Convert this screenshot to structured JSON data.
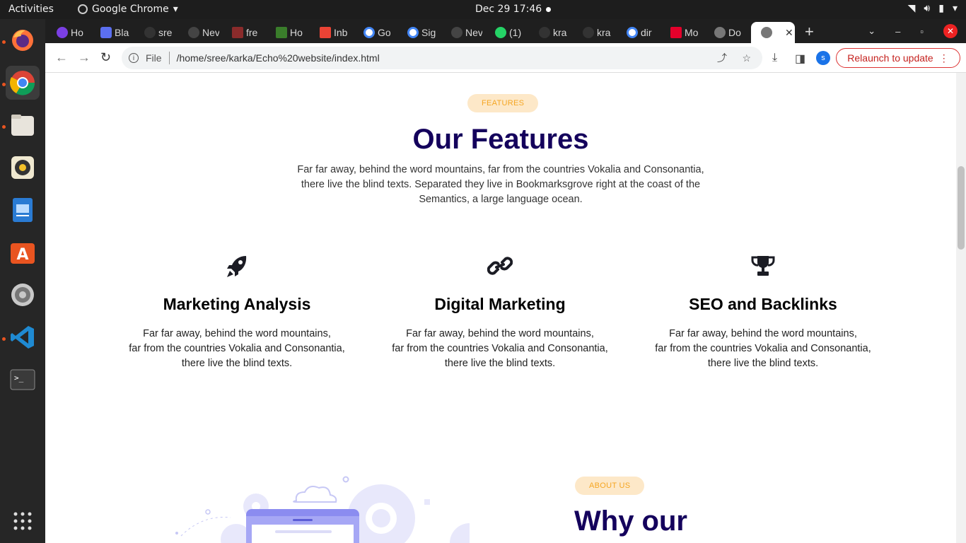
{
  "system": {
    "activities": "Activities",
    "app_name": "Google Chrome",
    "clock": "Dec 29  17:46"
  },
  "browser": {
    "tabs": [
      "Ho",
      "Bla",
      "sre",
      "Nev",
      "fre",
      "Ho",
      "Inb",
      "Go",
      "Sig",
      "Nev",
      "(1)",
      "kra",
      "kra",
      "dir",
      "Mo",
      "Do"
    ],
    "active_tab_icon": "globe-icon",
    "address": {
      "scheme_label": "File",
      "path": "/home/sree/karka/Echo%20website/index.html"
    },
    "profile_initial": "s",
    "relaunch_label": "Relaunch to update"
  },
  "features_section": {
    "badge": "FEATURES",
    "title": "Our Features",
    "description_lines": [
      "Far far away, behind the word mountains, far from the countries Vokalia and Consonantia,",
      "there live the blind texts. Separated they live in Bookmarksgrove right at the coast of the",
      "Semantics, a large language ocean."
    ],
    "items": [
      {
        "icon": "rocket-icon",
        "title": "Marketing Analysis",
        "lines": [
          "Far far away, behind the word mountains,",
          "far from the countries Vokalia and Consonantia,",
          "there live the blind texts."
        ]
      },
      {
        "icon": "link-icon",
        "title": "Digital Marketing",
        "lines": [
          "Far far away, behind the word mountains,",
          "far from the countries Vokalia and Consonantia,",
          "there live the blind texts."
        ]
      },
      {
        "icon": "trophy-icon",
        "title": "SEO and Backlinks",
        "lines": [
          "Far far away, behind the word mountains,",
          "far from the countries Vokalia and Consonantia,",
          "there live the blind texts."
        ]
      }
    ]
  },
  "about_section": {
    "badge": "ABOUT US",
    "title": "Why our"
  },
  "colors": {
    "heading": "#14005c",
    "badge_bg": "#fde8c8",
    "badge_text": "#f5a623",
    "illustration": "#8b8cf0"
  }
}
